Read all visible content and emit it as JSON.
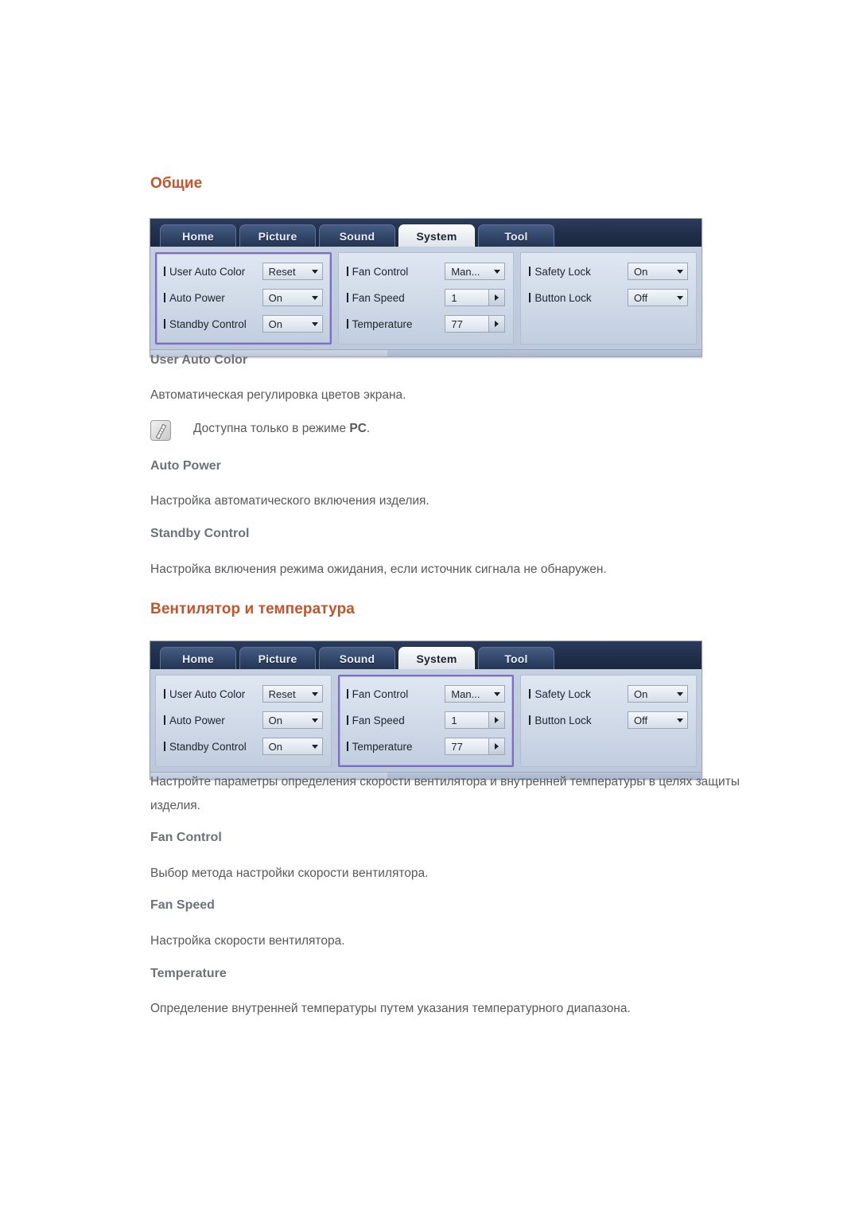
{
  "sections": [
    {
      "heading": "Общие",
      "osd": {
        "tabs": [
          {
            "label": "Home",
            "active": false
          },
          {
            "label": "Picture",
            "active": false
          },
          {
            "label": "Sound",
            "active": false
          },
          {
            "label": "System",
            "active": true
          },
          {
            "label": "Tool",
            "active": false
          }
        ],
        "columns": [
          {
            "highlighted": true,
            "rows": [
              {
                "label": "User Auto Color",
                "value": "Reset",
                "control": "dropdown"
              },
              {
                "label": "Auto Power",
                "value": "On",
                "control": "dropdown"
              },
              {
                "label": "Standby Control",
                "value": "On",
                "control": "dropdown"
              }
            ]
          },
          {
            "highlighted": false,
            "rows": [
              {
                "label": "Fan Control",
                "value": "Man...",
                "control": "dropdown"
              },
              {
                "label": "Fan Speed",
                "value": "1",
                "control": "stepper"
              },
              {
                "label": "Temperature",
                "value": "77",
                "control": "stepper"
              }
            ]
          },
          {
            "highlighted": false,
            "rows": [
              {
                "label": "Safety Lock",
                "value": "On",
                "control": "dropdown"
              },
              {
                "label": "Button Lock",
                "value": "Off",
                "control": "dropdown"
              }
            ]
          }
        ]
      },
      "items": [
        {
          "title": "User Auto Color",
          "body": "Автоматическая регулировка цветов экрана.",
          "note": {
            "icon": "note-pen-icon",
            "text_before": "Доступна только в режиме ",
            "text_bold": "PC",
            "text_after": "."
          }
        },
        {
          "title": "Auto Power",
          "body": "Настройка автоматического включения изделия."
        },
        {
          "title": "Standby Control",
          "body": "Настройка включения режима ожидания, если источник сигнала не обнаружен."
        }
      ]
    },
    {
      "heading": "Вентилятор и температура",
      "intro": "Настройте параметры определения скорости вентилятора и внутренней температуры в целях защиты изделия.",
      "osd": {
        "tabs": [
          {
            "label": "Home",
            "active": false
          },
          {
            "label": "Picture",
            "active": false
          },
          {
            "label": "Sound",
            "active": false
          },
          {
            "label": "System",
            "active": true
          },
          {
            "label": "Tool",
            "active": false
          }
        ],
        "columns": [
          {
            "highlighted": false,
            "rows": [
              {
                "label": "User Auto Color",
                "value": "Reset",
                "control": "dropdown"
              },
              {
                "label": "Auto Power",
                "value": "On",
                "control": "dropdown"
              },
              {
                "label": "Standby Control",
                "value": "On",
                "control": "dropdown"
              }
            ]
          },
          {
            "highlighted": true,
            "rows": [
              {
                "label": "Fan Control",
                "value": "Man...",
                "control": "dropdown"
              },
              {
                "label": "Fan Speed",
                "value": "1",
                "control": "stepper"
              },
              {
                "label": "Temperature",
                "value": "77",
                "control": "stepper"
              }
            ]
          },
          {
            "highlighted": false,
            "rows": [
              {
                "label": "Safety Lock",
                "value": "On",
                "control": "dropdown"
              },
              {
                "label": "Button Lock",
                "value": "Off",
                "control": "dropdown"
              }
            ]
          }
        ]
      },
      "items": [
        {
          "title": "Fan Control",
          "body": "Выбор метода настройки скорости вентилятора."
        },
        {
          "title": "Fan Speed",
          "body": "Настройка скорости вентилятора."
        },
        {
          "title": "Temperature",
          "body": "Определение внутренней температуры путем указания температурного диапазона."
        }
      ]
    }
  ],
  "colors": {
    "heading": "#c4552a",
    "sub_heading": "#6d7278",
    "body_text": "#58595b",
    "osd_tabbar": "#22304c",
    "osd_highlight": "#7b6cc4"
  }
}
